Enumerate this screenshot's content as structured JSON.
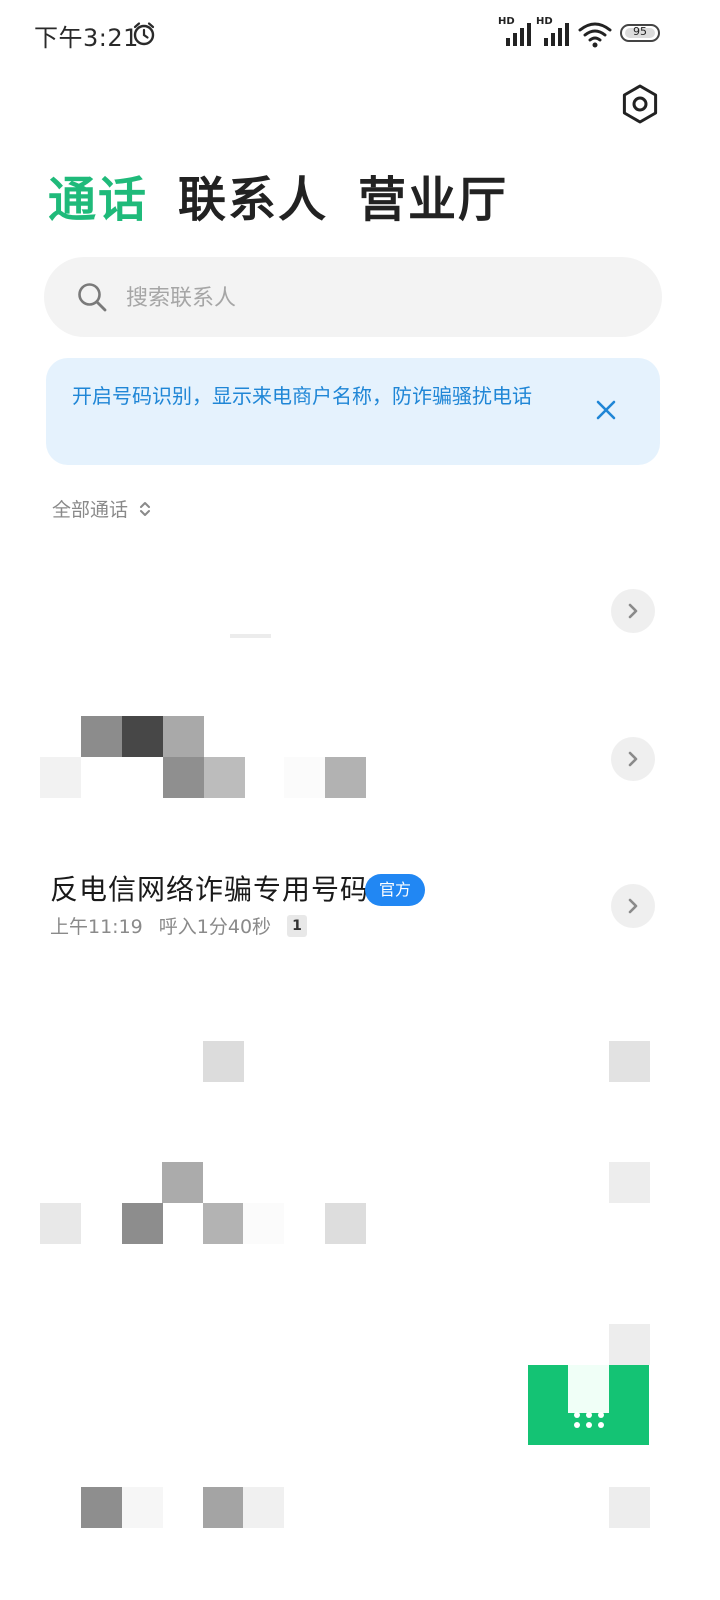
{
  "status_bar": {
    "time": "下午3:21",
    "sim1_label": "HD",
    "sim2_label": "HD",
    "battery_level": "95"
  },
  "tabs": [
    {
      "label": "通话",
      "active": true
    },
    {
      "label": "联系人",
      "active": false
    },
    {
      "label": "营业厅",
      "active": false
    }
  ],
  "search": {
    "placeholder": "搜索联系人"
  },
  "banner": {
    "text": "开启号码识别，显示来电商户名称，防诈骗骚扰电话"
  },
  "filter": {
    "label": "全部通话"
  },
  "call_entry": {
    "name": "反电信网络诈骗专用号码",
    "badge": "官方",
    "time": "上午11:19",
    "detail": "呼入1分40秒",
    "count": "1"
  },
  "colors": {
    "accent_green": "#1fba7a",
    "banner_bg": "#e5f2fd",
    "banner_text": "#1f86d6",
    "badge_blue": "#2187f3"
  },
  "icons": [
    "alarm-icon",
    "signal-icon",
    "wifi-icon",
    "battery-icon",
    "settings-icon",
    "search-icon",
    "close-icon",
    "sort-icon",
    "chevron-right-icon"
  ]
}
